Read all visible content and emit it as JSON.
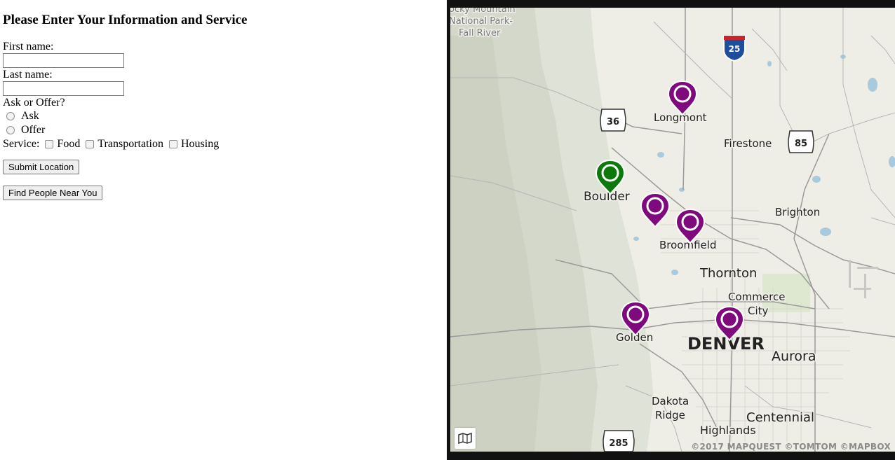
{
  "form": {
    "title": "Please Enter Your Information and Service",
    "first_name_label": "First name:",
    "first_name_value": "",
    "last_name_label": "Last name:",
    "last_name_value": "",
    "ask_offer_label": "Ask or Offer?",
    "ask_label": "Ask",
    "offer_label": "Offer",
    "service_label": "Service:",
    "services": [
      "Food",
      "Transportation",
      "Housing"
    ],
    "submit_button": "Submit Location",
    "find_button": "Find People Near You"
  },
  "map": {
    "places": {
      "rocky_1": "ocky Mountain",
      "rocky_2": "National Park-",
      "rocky_3": "Fall River",
      "longmont": "Longmont",
      "firestone": "Firestone",
      "boulder": "Boulder",
      "brighton": "Brighton",
      "broomfield": "Broomfield",
      "thornton": "Thornton",
      "commerce_1": "Commerce",
      "commerce_2": "City",
      "golden": "Golden",
      "denver": "DENVER",
      "aurora": "Aurora",
      "dakota_1": "Dakota",
      "dakota_2": "Ridge",
      "highlands": "Highlands",
      "centennial": "Centennial"
    },
    "shields": {
      "i25": "25",
      "us36": "36",
      "us85": "85",
      "us285": "285"
    },
    "attribution": "©2017 MAPQUEST ©TOMTOM ©MAPBOX",
    "colors": {
      "user_marker": "#0b7a0b",
      "other_marker": "#7e0a7e"
    }
  }
}
